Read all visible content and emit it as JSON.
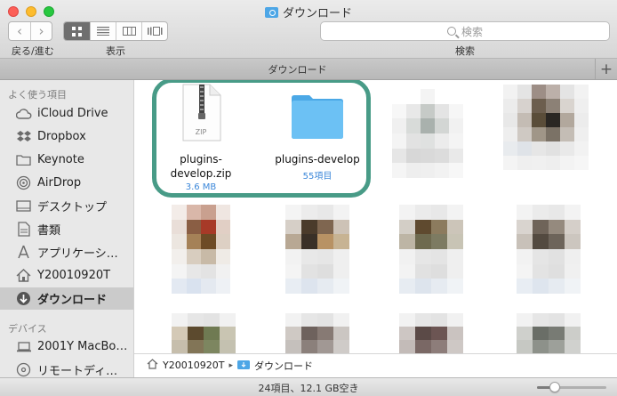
{
  "window": {
    "title": "ダウンロード",
    "title_icon": "downloads-folder-icon"
  },
  "toolbar": {
    "nav_label": "戻る/進む",
    "back_icon": "chevron-left-icon",
    "forward_icon": "chevron-right-icon",
    "view_label": "表示",
    "views": [
      "icon",
      "list",
      "column",
      "coverflow"
    ],
    "active_view": "icon",
    "search_label": "検索",
    "search_placeholder": "検索"
  },
  "tabbar": {
    "tab_label": "ダウンロード",
    "add_symbol": "+"
  },
  "sidebar": {
    "favorites_header": "よく使う項目",
    "favorites": [
      {
        "label": "iCloud Drive",
        "icon": "cloud-icon"
      },
      {
        "label": "Dropbox",
        "icon": "dropbox-icon"
      },
      {
        "label": "Keynote",
        "icon": "folder-icon"
      },
      {
        "label": "AirDrop",
        "icon": "airdrop-icon"
      },
      {
        "label": "デスクトップ",
        "icon": "desktop-icon"
      },
      {
        "label": "書類",
        "icon": "documents-icon"
      },
      {
        "label": "アプリケーシ…",
        "icon": "applications-icon"
      },
      {
        "label": "Y20010920T",
        "icon": "home-icon"
      },
      {
        "label": "ダウンロード",
        "icon": "download-icon",
        "selected": true
      }
    ],
    "devices_header": "デバイス",
    "devices": [
      {
        "label": "2001Y MacBo…",
        "icon": "laptop-icon"
      },
      {
        "label": "リモートディ…",
        "icon": "disc-icon"
      }
    ]
  },
  "files": [
    {
      "name": "plugins-develop.zip",
      "name_lines": [
        "plugins-",
        "develop.zip"
      ],
      "sub": "3.6 MB",
      "type": "zip",
      "badge": "ZIP"
    },
    {
      "name": "plugins-develop",
      "name_lines": [
        "plugins-develop"
      ],
      "sub": "55項目",
      "type": "folder"
    }
  ],
  "pathbar": {
    "segments": [
      "Y20010920T",
      "ダウンロード"
    ],
    "separator": "▸"
  },
  "status": {
    "text": "24項目、12.1 GB空き",
    "zoom_fraction": 0.25
  },
  "colors": {
    "highlight": "#489b87",
    "accent": "#3b87d9",
    "folder": "#62b7ef"
  }
}
